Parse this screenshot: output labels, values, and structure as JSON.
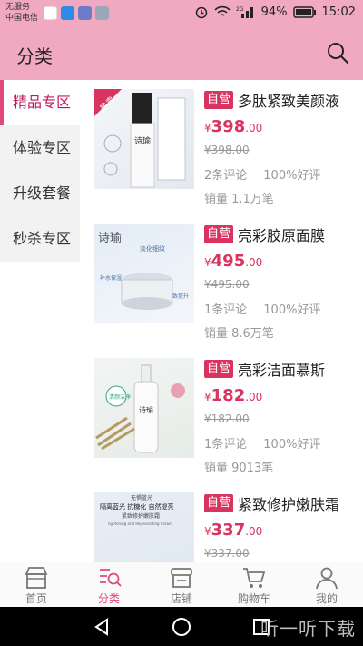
{
  "statusbar": {
    "carrier_line1": "无服务",
    "carrier_line2": "中国电信",
    "battery": "94%",
    "time": "15:02",
    "network": "2G"
  },
  "header": {
    "title": "分类"
  },
  "sidebar": {
    "items": [
      {
        "label": "精品专区",
        "active": true
      },
      {
        "label": "体验专区",
        "active": false
      },
      {
        "label": "升级套餐",
        "active": false
      },
      {
        "label": "秒杀专区",
        "active": false
      }
    ]
  },
  "products": [
    {
      "tag": "自营",
      "name": "多肽紧致美颜液",
      "currency": "¥",
      "price_main": "398",
      "price_dec": ".00",
      "old_price": "¥398.00",
      "reviews": "2条评论",
      "rating": "100%好评",
      "sales": "销量 1.1万笔",
      "badge": "热卖",
      "brand": "诗瑜"
    },
    {
      "tag": "自营",
      "name": "亮彩胶原面膜",
      "currency": "¥",
      "price_main": "495",
      "price_dec": ".00",
      "old_price": "¥495.00",
      "reviews": "1条评论",
      "rating": "100%好评",
      "sales": "销量 8.6万笔",
      "brand": "诗瑜",
      "label_a": "淡化细纹",
      "label_b": "补水保湿",
      "label_c": "紧致提升"
    },
    {
      "tag": "自营",
      "name": "亮彩洁面慕斯",
      "currency": "¥",
      "price_main": "182",
      "price_dec": ".00",
      "old_price": "¥182.00",
      "reviews": "1条评论",
      "rating": "100%好评",
      "sales": "销量 9013笔",
      "brand": "诗瑜",
      "label_a": "清颜洁净"
    },
    {
      "tag": "自营",
      "name": "紧致修护嫩肤霜",
      "currency": "¥",
      "price_main": "337",
      "price_dec": ".00",
      "old_price": "¥337.00",
      "brand": "诗瑜",
      "label_a": "无惧蓝光",
      "label_b": "隔离蓝光  抗糖化  自然提亮",
      "label_c": "紧致修护嫩肤霜",
      "label_d": "Tightening and Rejuvenating Cream"
    }
  ],
  "tabbar": {
    "tabs": [
      {
        "label": "首页",
        "icon": "store-icon"
      },
      {
        "label": "分类",
        "icon": "category-search-icon",
        "active": true
      },
      {
        "label": "店铺",
        "icon": "shop-icon"
      },
      {
        "label": "购物车",
        "icon": "cart-icon"
      },
      {
        "label": "我的",
        "icon": "user-icon"
      }
    ]
  },
  "watermark": "听一听下载",
  "colors": {
    "header_bg": "#f0a9c0",
    "accent": "#d8345f",
    "active_tab": "#e0497f"
  }
}
